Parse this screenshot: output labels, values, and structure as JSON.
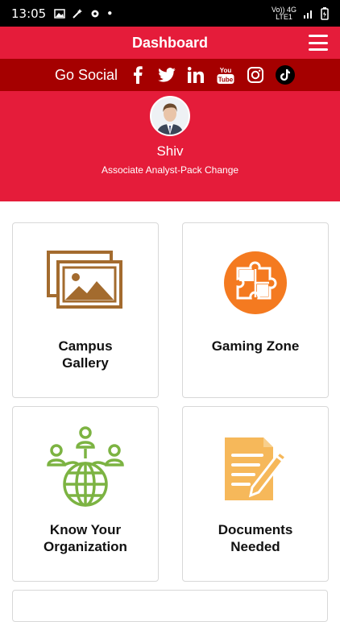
{
  "status_bar": {
    "time": "13:05",
    "network": "Vo)) 4G\nLTE1"
  },
  "header": {
    "title": "Dashboard"
  },
  "social": {
    "label": "Go Social",
    "icons": [
      "facebook-icon",
      "twitter-icon",
      "linkedin-icon",
      "youtube-icon",
      "instagram-icon",
      "tiktok-icon"
    ]
  },
  "profile": {
    "name": "Shiv",
    "role": "Associate Analyst-Pack Change"
  },
  "tiles": [
    {
      "label": "Campus\nGallery",
      "icon": "gallery-icon",
      "color": "#a36b2e"
    },
    {
      "label": "Gaming Zone",
      "icon": "puzzle-icon",
      "color": "#f47a20"
    },
    {
      "label": "Know Your\nOrganization",
      "icon": "organization-globe-icon",
      "color": "#7cb342"
    },
    {
      "label": "Documents\nNeeded",
      "icon": "document-edit-icon",
      "color": "#f6b85a"
    }
  ],
  "colors": {
    "primary": "#e51c3a",
    "social_bar": "#a50000"
  }
}
